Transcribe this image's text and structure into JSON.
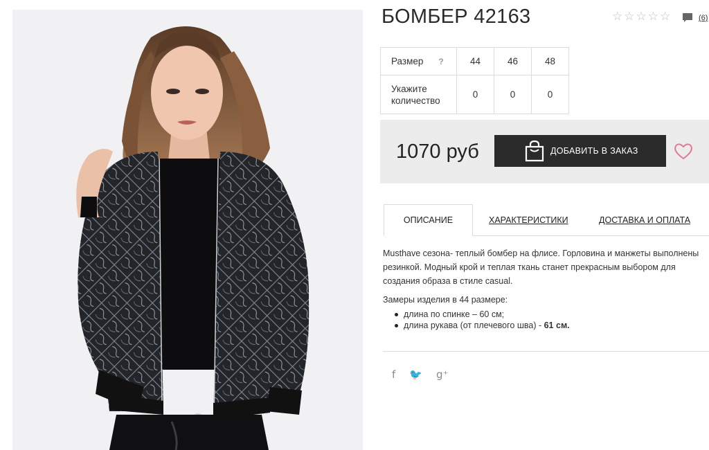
{
  "product": {
    "title": "БОМБЕР 42163",
    "rating_stars": [
      "☆",
      "☆",
      "☆",
      "☆",
      "☆"
    ],
    "comment_count": "(6)",
    "photo_icon": "product-photo"
  },
  "sizes": {
    "size_label": "Размер",
    "help": "?",
    "values": [
      "44",
      "46",
      "48"
    ],
    "qty_label_line1": "Укажите",
    "qty_label_line2": "количество",
    "quantities": [
      "0",
      "0",
      "0"
    ]
  },
  "purchase": {
    "price": "1070 руб",
    "order_button": "ДОБАВИТЬ В ЗАКАЗ",
    "bag_icon": "shopping-bag-icon",
    "wishlist_icon": "heart-icon"
  },
  "tabs": [
    {
      "label": "ОПИСАНИЕ",
      "active": true
    },
    {
      "label": "ХАРАКТЕРИСТИКИ",
      "active": false
    },
    {
      "label": "ДОСТАВКА И ОПЛАТА",
      "active": false
    }
  ],
  "description": {
    "text": "Musthave сезона- теплый бомбер на флисе. Горловина и манжеты выполнены резинкой. Модный крой и теплая ткань станет прекрасным выбором для создания образа в стиле casual.",
    "measure_title": "Замеры изделия в 44 размере:",
    "measure_1": "длина по спинке – 60 см;",
    "measure_2_prefix": "длина рукава (от плечевого шва) - ",
    "measure_2_value": "61 см."
  },
  "social": {
    "facebook": "f",
    "twitter": "🐦",
    "google": "g⁺"
  },
  "colors": {
    "button_bg": "#2b2b2b",
    "price_bg": "#ececec",
    "heart": "#e07a92"
  }
}
